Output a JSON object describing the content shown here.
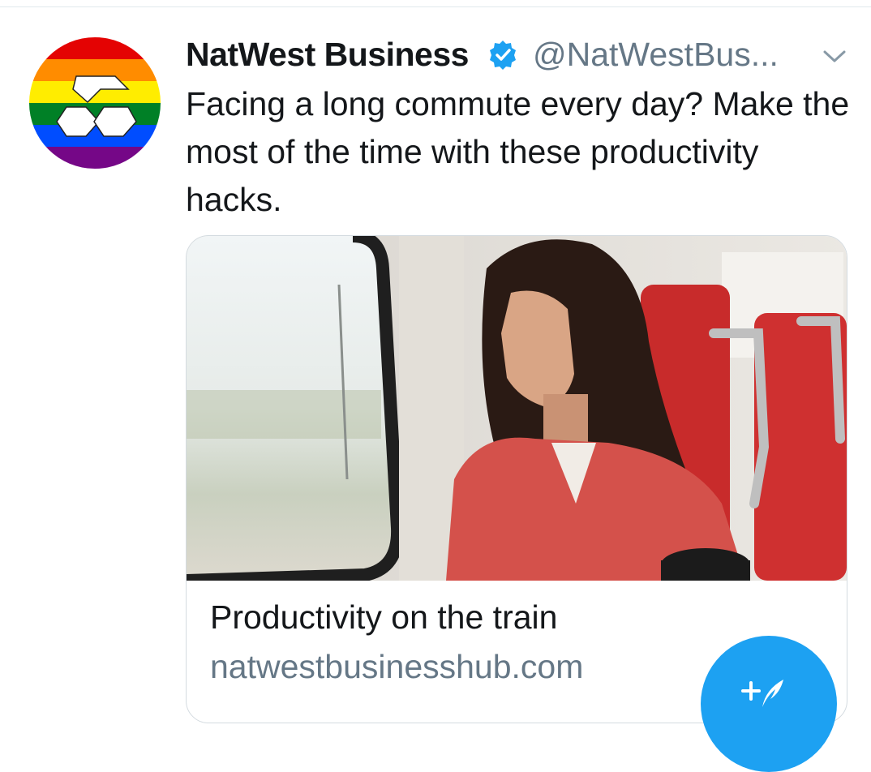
{
  "tweet": {
    "author": {
      "display_name": "NatWest Business",
      "handle": "@NatWestBus...",
      "verified": true,
      "avatar_icon": "natwest-rainbow-logo-icon"
    },
    "text": "Facing a long commute every day? Make the most of the time with these productivity hacks.",
    "menu_icon": "chevron-down-icon"
  },
  "card": {
    "image_icon": "woman-on-train-photo",
    "title": "Productivity on the train",
    "domain": "natwestbusinesshub.com"
  },
  "fab": {
    "icon": "compose-tweet-icon"
  },
  "colors": {
    "accent": "#1da1f2",
    "text_primary": "#14171a",
    "text_secondary": "#657786",
    "border": "#d4dbe0"
  }
}
